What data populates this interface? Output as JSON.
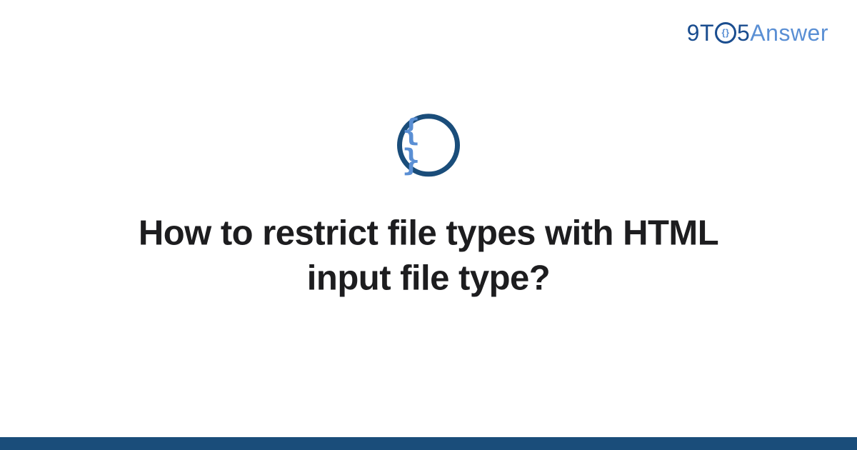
{
  "brand": {
    "part1": "9T",
    "circle_inner": "{}",
    "part2": "5",
    "part3": "Answer"
  },
  "badge": {
    "glyph": "{ }"
  },
  "question": {
    "title": "How to restrict file types with HTML input file type?"
  },
  "colors": {
    "dark_blue": "#1a4d7a",
    "light_blue": "#5a8fd4"
  }
}
